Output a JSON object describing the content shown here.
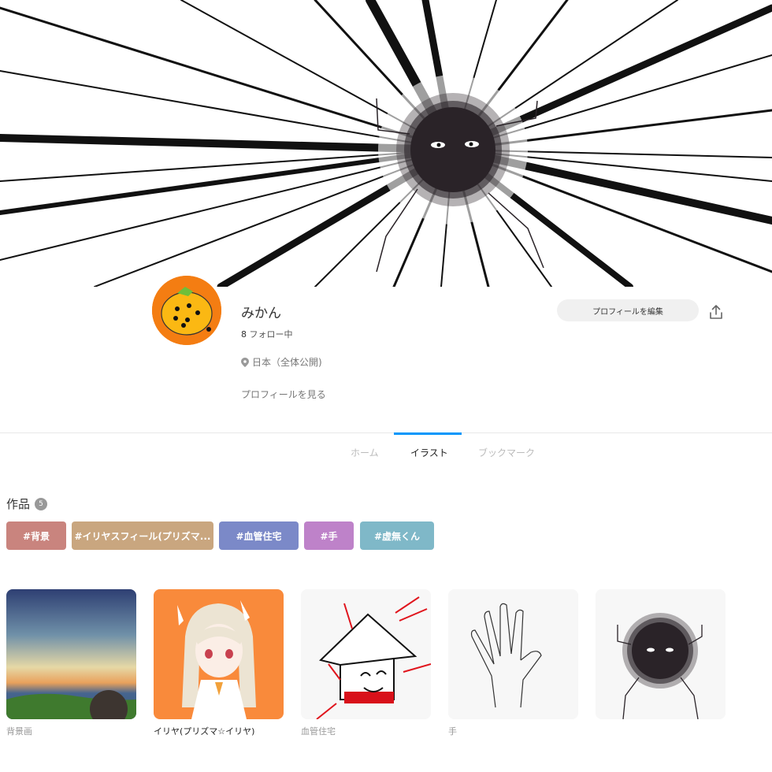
{
  "profile": {
    "name": "みかん",
    "follow_count": "8",
    "follow_label": "フォロー中",
    "location": "日本（全体公開)",
    "view_profile": "プロフィールを見る",
    "edit_button": "プロフィールを編集"
  },
  "tabs": [
    {
      "label": "ホーム",
      "active": false
    },
    {
      "label": "イラスト",
      "active": true
    },
    {
      "label": "ブックマーク",
      "active": false
    }
  ],
  "works": {
    "title": "作品",
    "count": "5"
  },
  "tags": [
    {
      "label": "#背景",
      "color": "#c9847e"
    },
    {
      "label": "#イリヤスフィール(プリズマ...",
      "color": "#c9a67f"
    },
    {
      "label": "#血管住宅",
      "color": "#7b89c8"
    },
    {
      "label": "#手",
      "color": "#be82c9"
    },
    {
      "label": "#虚無くん",
      "color": "#7fb8c8"
    }
  ],
  "artworks": [
    {
      "title": "背景画"
    },
    {
      "title": "イリヤ(プリズマ☆イリヤ)"
    },
    {
      "title": "血管住宅"
    },
    {
      "title": "手"
    },
    {
      "title": ""
    }
  ],
  "colors": {
    "accent": "#0096fa",
    "avatar_bg": "#f47d12"
  }
}
